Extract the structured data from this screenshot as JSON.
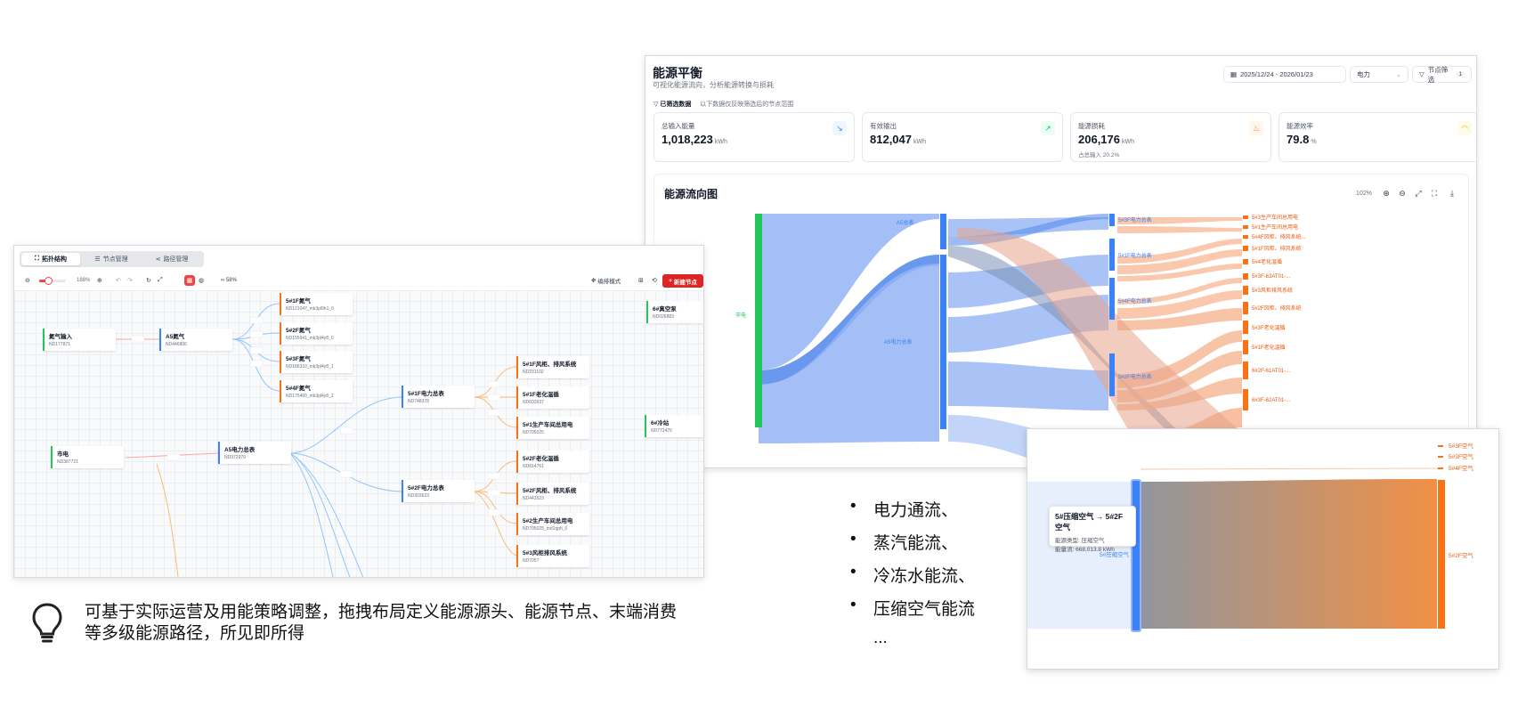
{
  "dashboard": {
    "title": "能源平衡",
    "subtitle": "可视化能源流向，分析能源转换与损耗",
    "date_range": "2025/12/24 - 2026/01/23",
    "energy_select": "电力",
    "node_filter_label": "节点筛选",
    "node_filter_count": "1",
    "filter_tag": "已筛选数据",
    "filter_note": "以下数据仅反映筛选后的节点范围",
    "cards": [
      {
        "label": "总输入能量",
        "value": "1,018,223",
        "unit": "kWh",
        "note": "",
        "icon": "arrow-down-right-icon",
        "color": "#3b82f6"
      },
      {
        "label": "有效输出",
        "value": "812,047",
        "unit": "kWh",
        "note": "",
        "icon": "arrow-up-right-icon",
        "color": "#22c55e"
      },
      {
        "label": "能源损耗",
        "value": "206,176",
        "unit": "kWh",
        "note": "占总输入 20.2%",
        "icon": "flame-icon",
        "color": "#f97316"
      },
      {
        "label": "能源效率",
        "value": "79.8",
        "unit": "%",
        "note": "",
        "icon": "gauge-icon",
        "color": "#f59e0b"
      }
    ],
    "flow": {
      "title": "能源流向图",
      "zoom": "102%",
      "source_label": "市电",
      "mid_labels": [
        "A5总表",
        "A5电力总表"
      ],
      "sub_labels": [
        "5#3F电力总表",
        "5#1F电力总表",
        "5#4F电力总表",
        "5#2F电力总表"
      ],
      "outputs": [
        "5#3生产车间总用电",
        "5#1生产车间总用电",
        "5#4F风柜、排风系统...",
        "5#1F风柜、排风系统",
        "5#4老化温循",
        "5#3F-63AT01-...",
        "5#3风柜排风系统",
        "5#2F风柜、排风系统",
        "5#3F老化温循",
        "5#1F老化温循",
        "6#2F-61AT01-...",
        "6#3F-62AT01-..."
      ]
    }
  },
  "zoom_panel": {
    "top_labels": [
      "5#3F空气",
      "5#3F空气",
      "5#4F空气"
    ],
    "left_label": "5#压缩空气",
    "right_label": "5#2F空气",
    "tooltip": {
      "title": "5#压缩空气 → 5#2F空气",
      "type": "能源类型: 压缩空气",
      "flow": "能量流: 668,013.8 kWh"
    }
  },
  "topology": {
    "tabs": [
      "拓扑结构",
      "节点管理",
      "路径管理"
    ],
    "zoom_value": "188%",
    "edit_mode": "编排模式",
    "link_info": "58%",
    "new_node": "新建节点",
    "nodes": [
      {
        "name": "氮气输入",
        "id": "ND177871",
        "color": "#22c55e"
      },
      {
        "name": "A5氮气",
        "id": "ND446806",
        "color": "#3b82f6"
      },
      {
        "name": "5#1F氮气",
        "id": "ND121047_mk3pl9h1_0",
        "color": "#f97316"
      },
      {
        "name": "5#2F氮气",
        "id": "ND155941_mk3pl4y8_0",
        "color": "#f97316"
      },
      {
        "name": "5#3F氮气",
        "id": "ND186310_mk3pl4y8_1",
        "color": "#f97316"
      },
      {
        "name": "5#4F氮气",
        "id": "ND175460_mk3pl4y8_2",
        "color": "#f97316"
      },
      {
        "name": "5#1F风柜、排风系统",
        "id": "ND231102",
        "color": "#f97316"
      },
      {
        "name": "5#1F电力总表",
        "id": "ND748378",
        "color": "#3b82f6"
      },
      {
        "name": "5#1F老化温循",
        "id": "ND693937",
        "color": "#f97316"
      },
      {
        "name": "5#1生产车间总用电",
        "id": "ND705025",
        "color": "#f97316"
      },
      {
        "name": "市电",
        "id": "ND387721",
        "color": "#22c55e"
      },
      {
        "name": "A5电力总表",
        "id": "ND972979",
        "color": "#3b82f6"
      },
      {
        "name": "5#2F老化温循",
        "id": "ND814761",
        "color": "#f97316"
      },
      {
        "name": "5#2F电力总表",
        "id": "ND303623",
        "color": "#3b82f6"
      },
      {
        "name": "5#2F风柜、排风系统",
        "id": "ND443523",
        "color": "#f97316"
      },
      {
        "name": "5#2生产车间总用电",
        "id": "ND705025_md1qph_0",
        "color": "#f97316"
      },
      {
        "name": "5#3风柜排风系统",
        "id": "ND705?",
        "color": "#f97316"
      },
      {
        "name": "6#真空泵",
        "id": "ND026883",
        "color": "#22c55e"
      },
      {
        "name": "6#冷站",
        "id": "ND772476",
        "color": "#22c55e"
      }
    ]
  },
  "caption": "可基于实际运营及用能策略调整，拖拽布局定义能源源头、能源节点、末端消费等多级能源路径，所见即所得",
  "bullets": [
    "电力通流、",
    "蒸汽能流、",
    "冷冻水能流、",
    "压缩空气能流"
  ],
  "bullets_more": "..."
}
